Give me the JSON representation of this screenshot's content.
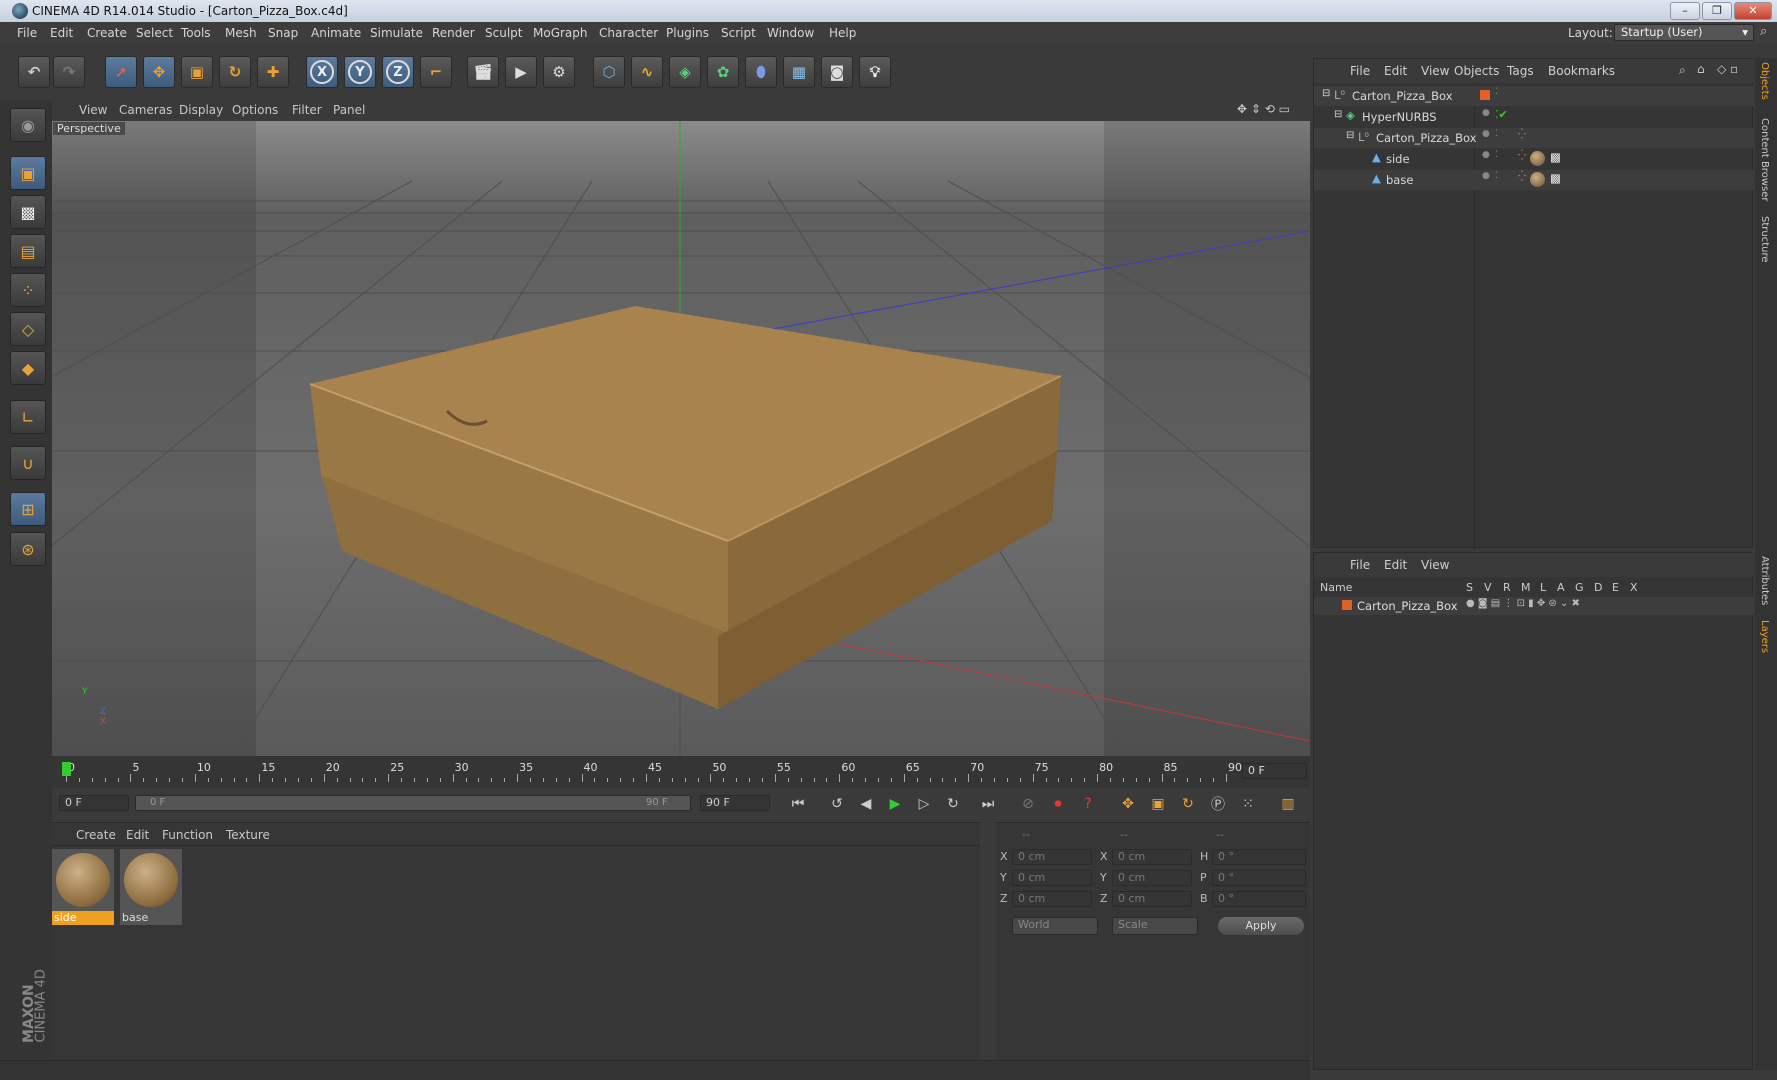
{
  "window": {
    "title": "CINEMA 4D R14.014 Studio - [Carton_Pizza_Box.c4d]",
    "controls": [
      "–",
      "❐",
      "✕"
    ]
  },
  "menubar": {
    "items": [
      "File",
      "Edit",
      "Create",
      "Select",
      "Tools",
      "Mesh",
      "Snap",
      "Animate",
      "Simulate",
      "Render",
      "Sculpt",
      "MoGraph",
      "Character",
      "Plugins",
      "Script",
      "Window",
      "Help"
    ],
    "layout_label": "Layout:",
    "layout_value": "Startup (User)"
  },
  "viewport": {
    "menu": [
      "View",
      "Cameras",
      "Display",
      "Options",
      "Filter",
      "Panel"
    ],
    "label": "Perspective",
    "axis_y": "Y",
    "axis_x": "X",
    "axis_z": "Z"
  },
  "toolbar": {
    "axis_labels": [
      "X",
      "Y",
      "Z"
    ]
  },
  "object_manager": {
    "menu": [
      "File",
      "Edit",
      "View",
      "Objects",
      "Tags",
      "Bookmarks"
    ],
    "tree": [
      {
        "name": "Carton_Pizza_Box",
        "indent": 0
      },
      {
        "name": "HyperNURBS",
        "indent": 1
      },
      {
        "name": "Carton_Pizza_Box",
        "indent": 2
      },
      {
        "name": "side",
        "indent": 3
      },
      {
        "name": "base",
        "indent": 3
      }
    ]
  },
  "layer_manager": {
    "menu": [
      "File",
      "Edit",
      "View"
    ],
    "headers": [
      "Name",
      "S",
      "V",
      "R",
      "M",
      "L",
      "A",
      "G",
      "D",
      "E",
      "X"
    ],
    "row_name": "Carton_Pizza_Box"
  },
  "side_tabs": {
    "top": [
      "Objects",
      "Content Browser",
      "Structure"
    ],
    "bottom": [
      "Attributes",
      "Layers"
    ]
  },
  "timeline": {
    "ticks": [
      "0",
      "5",
      "10",
      "15",
      "20",
      "25",
      "30",
      "35",
      "40",
      "45",
      "50",
      "55",
      "60",
      "65",
      "70",
      "75",
      "80",
      "85",
      "90"
    ],
    "current_frame": "0 F",
    "start_field": "0 F",
    "slider_start": "0 F",
    "slider_end": "90 F",
    "end_field": "90 F"
  },
  "material_manager": {
    "menu": [
      "Create",
      "Edit",
      "Function",
      "Texture"
    ],
    "materials": [
      "side",
      "base"
    ]
  },
  "coordinates": {
    "header": [
      "--",
      "--",
      "--"
    ],
    "rows": [
      {
        "l1": "X",
        "v1": "0 cm",
        "l2": "X",
        "v2": "0 cm",
        "l3": "H",
        "v3": "0 °"
      },
      {
        "l1": "Y",
        "v1": "0 cm",
        "l2": "Y",
        "v2": "0 cm",
        "l3": "P",
        "v3": "0 °"
      },
      {
        "l1": "Z",
        "v1": "0 cm",
        "l2": "Z",
        "v2": "0 cm",
        "l3": "B",
        "v3": "0 °"
      }
    ],
    "mode1": "World",
    "mode2": "Scale",
    "apply": "Apply"
  },
  "logo": {
    "brand": "MAXON",
    "product": "CINEMA 4D"
  },
  "colors": {
    "accent": "#f0a020",
    "select_blue": "#4a6a90",
    "box": "#a8834e"
  }
}
